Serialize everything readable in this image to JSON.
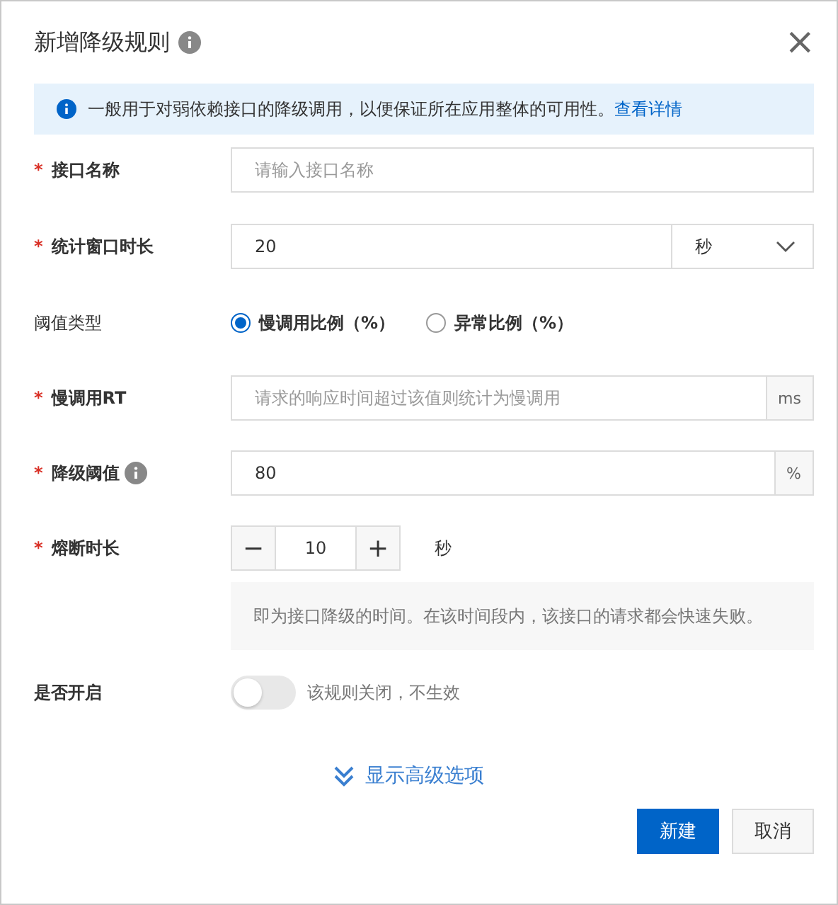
{
  "dialog": {
    "title": "新增降级规则",
    "title_info": true,
    "close": "×"
  },
  "banner": {
    "text": "一般用于对弱依赖接口的降级调用，以便保证所在应用整体的可用性。",
    "link": "查看详情"
  },
  "fields": [
    {
      "kind": "text",
      "label": "接口名称",
      "required_mark": "*",
      "placeholder": "请输入接口名称"
    },
    {
      "kind": "select",
      "label": "统计窗口时长",
      "required_mark": "*",
      "value": "20",
      "unit": "秒"
    },
    {
      "kind": "radio",
      "label": "阈值类型",
      "options": [
        {
          "label": "慢调用比例（%）",
          "selected": true
        },
        {
          "label": "异常比例（%）",
          "selected": false
        }
      ]
    },
    {
      "kind": "suffix",
      "label": "慢调用RT",
      "required_mark": "*",
      "placeholder": "请求的响应时间超过该值则统计为慢调用",
      "suffix": "ms"
    },
    {
      "kind": "suffix",
      "label": "降级阈值",
      "required_mark": "*",
      "info": true,
      "value": "80",
      "suffix": "%"
    },
    {
      "kind": "stepper",
      "label": "熔断时长",
      "required_mark": "*",
      "minus": "−",
      "value": "10",
      "plus": "+",
      "unit": "秒",
      "note": "即为接口降级的时间。在该时间段内，该接口的请求都会快速失败。"
    },
    {
      "kind": "switch",
      "label": "是否开启",
      "on": false,
      "hint": "该规则关闭，不生效"
    }
  ],
  "advanced": "显示高级选项",
  "buttons": [
    {
      "label": "新建",
      "primary": true
    },
    {
      "label": "取消",
      "primary": false
    }
  ]
}
